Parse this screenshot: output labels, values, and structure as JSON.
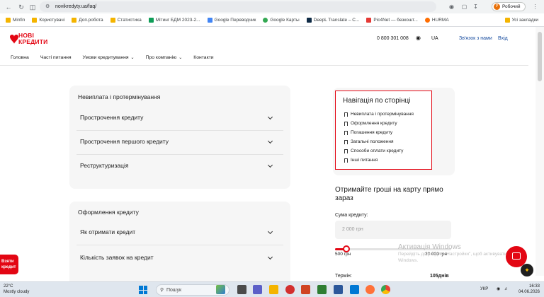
{
  "browser": {
    "url": "novikredyty.ua/faq/",
    "profile_label": "Робочий",
    "profile_initial": "Р",
    "all_bookmarks": "Усі закладки",
    "bookmarks": [
      "Minfin",
      "Користувачі",
      "Доп.робота",
      "Статистика",
      "Мітинг БДМ 2023-2...",
      "Google Переводчик",
      "Google Карты",
      "DeepL Translate – C...",
      "Pic4Net — безкошт...",
      "HURMA"
    ]
  },
  "site": {
    "logo_line1": "НОВІ",
    "logo_line2": "КРЕДИТИ",
    "phone": "0 800 301 008",
    "lang": "UA",
    "contact": "Зв'язок з нами",
    "login": "Вхід",
    "nav": [
      "Головна",
      "Часті питання",
      "Умови кредитування",
      "Про компанію",
      "Контакти"
    ],
    "brand_color": "#e30613"
  },
  "faq": {
    "card1": {
      "title": "Невиплата і протермінування",
      "items": [
        "Прострочення кредиту",
        "Прострочення першого кредиту",
        "Реструктуризація"
      ]
    },
    "card2": {
      "title": "Оформлення кредиту",
      "items": [
        "Як отримати кредит",
        "Кількість заявок на кредит"
      ]
    }
  },
  "page_nav": {
    "title": "Навігація по сторінці",
    "links": [
      "Невиплата і протермінування",
      "Оформлення кредиту",
      "Погашення кредиту",
      "Загальні положення",
      "Способи оплати кредиту",
      "Інші питання"
    ]
  },
  "promo": {
    "title": "Отримайте гроші на карту прямо зараз",
    "amount_label": "Сума кредиту:",
    "amount_placeholder": "2 000 грн",
    "slider_min": "500 грн",
    "slider_max": "20 000 грн",
    "term_label": "Термін:",
    "term_value": "105днів",
    "slider_fraction": 0.1
  },
  "side_tab": {
    "line1": "Взяти",
    "line2": "кредит"
  },
  "windows": {
    "activation_title": "Активація Windows",
    "activation_text": "Перейдіть до розділу \"Настройки\", щоб активувати Windows."
  },
  "taskbar": {
    "temp": "22°C",
    "weather": "Mostly cloudy",
    "search": "Пошук",
    "lang": "УКР",
    "time": "16:33",
    "date": "04.06.2026"
  }
}
